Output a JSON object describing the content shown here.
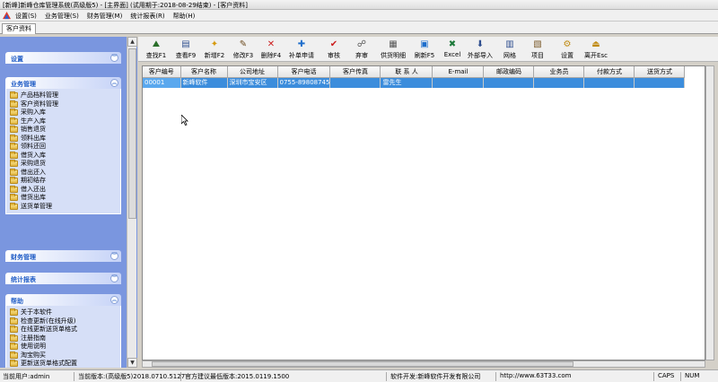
{
  "window": {
    "title": "[新峰]新峰仓库管理系统(高级版5) - [主界面] (试用期于:2018-08-29结束) - [客户资料]"
  },
  "menu": [
    "设置(S)",
    "业务管理(S)",
    "财务管理(M)",
    "统计报表(R)",
    "帮助(H)"
  ],
  "tabs": [
    {
      "label": "客户资料"
    }
  ],
  "sidebar": {
    "groups": [
      {
        "title": "设置",
        "items": []
      },
      {
        "title": "业务管理",
        "items": [
          "产品档料管理",
          "客户资料管理",
          "采购入库",
          "生产入库",
          "销售退货",
          "领料出库",
          "领料还回",
          "借货入库",
          "采购退货",
          "借出还入",
          "期初结存",
          "借入还出",
          "借货出库",
          "送货单管理"
        ]
      },
      {
        "title": "财务管理",
        "items": []
      },
      {
        "title": "统计报表",
        "items": []
      },
      {
        "title": "帮助",
        "items": [
          "关于本软件",
          "检查更新(在线升级)",
          "在线更新送货单格式",
          "注册指南",
          "使用说明",
          "淘宝购买",
          "更新送货单格式配置"
        ]
      }
    ]
  },
  "toolbar": [
    {
      "label": "查找F1",
      "icon": "binoculars-icon",
      "glyph": "⛰",
      "color": "#2a6f2a"
    },
    {
      "label": "查看F9",
      "icon": "view-icon",
      "glyph": "▤",
      "color": "#2f4f8f"
    },
    {
      "label": "新增F2",
      "icon": "new-icon",
      "glyph": "✦",
      "color": "#d69a10"
    },
    {
      "label": "修改F3",
      "icon": "edit-icon",
      "glyph": "✎",
      "color": "#6b4a1e"
    },
    {
      "label": "删除F4",
      "icon": "delete-icon",
      "glyph": "✕",
      "color": "#cc1f1f"
    },
    {
      "label": "补单申请",
      "icon": "apply-icon",
      "glyph": "✚",
      "color": "#1f6fcc"
    },
    {
      "label": "审核",
      "icon": "check-icon",
      "glyph": "✔",
      "color": "#cc1f1f"
    },
    {
      "label": "弃审",
      "icon": "unapprove-icon",
      "glyph": "☍",
      "color": "#555555"
    },
    {
      "label": "供货明细",
      "icon": "detail-icon",
      "glyph": "▦",
      "color": "#555555"
    },
    {
      "label": "刷新F5",
      "icon": "refresh-icon",
      "glyph": "▣",
      "color": "#1f6fcc"
    },
    {
      "label": "Excel",
      "icon": "excel-icon",
      "glyph": "✖",
      "color": "#1d7a3a"
    },
    {
      "label": "外部导入",
      "icon": "import-icon",
      "glyph": "⬇",
      "color": "#2f4f8f"
    },
    {
      "label": "网格",
      "icon": "grid-icon",
      "glyph": "▥",
      "color": "#2f4f8f"
    },
    {
      "label": "项目",
      "icon": "project-icon",
      "glyph": "▧",
      "color": "#7a5a2a"
    },
    {
      "label": "设置",
      "icon": "gear-icon",
      "glyph": "⚙",
      "color": "#c08a10"
    },
    {
      "label": "离开Esc",
      "icon": "exit-icon",
      "glyph": "⏏",
      "color": "#c08a10"
    }
  ],
  "table": {
    "columns": [
      "客户编号",
      "客户名称",
      "公司地址",
      "客户电话",
      "客户传真",
      "联 系 人",
      "E-mail",
      "邮政编码",
      "业务员",
      "付款方式",
      "送货方式"
    ],
    "rows": [
      [
        "00001",
        "新峰软件",
        "深圳市宝安区",
        "0755-89808745",
        "",
        "雷先生",
        "",
        "",
        "",
        "",
        ""
      ]
    ]
  },
  "status": {
    "user": "当前用户:admin",
    "version": "当前版本:(高级版5)2018.0710.5127",
    "recommend": "官方建议最低版本:2015.0119.1500",
    "developer": "软件开发:新峰软件开发有限公司",
    "website": "http://www.63T33.com",
    "caps": "CAPS",
    "num": "NUM"
  }
}
